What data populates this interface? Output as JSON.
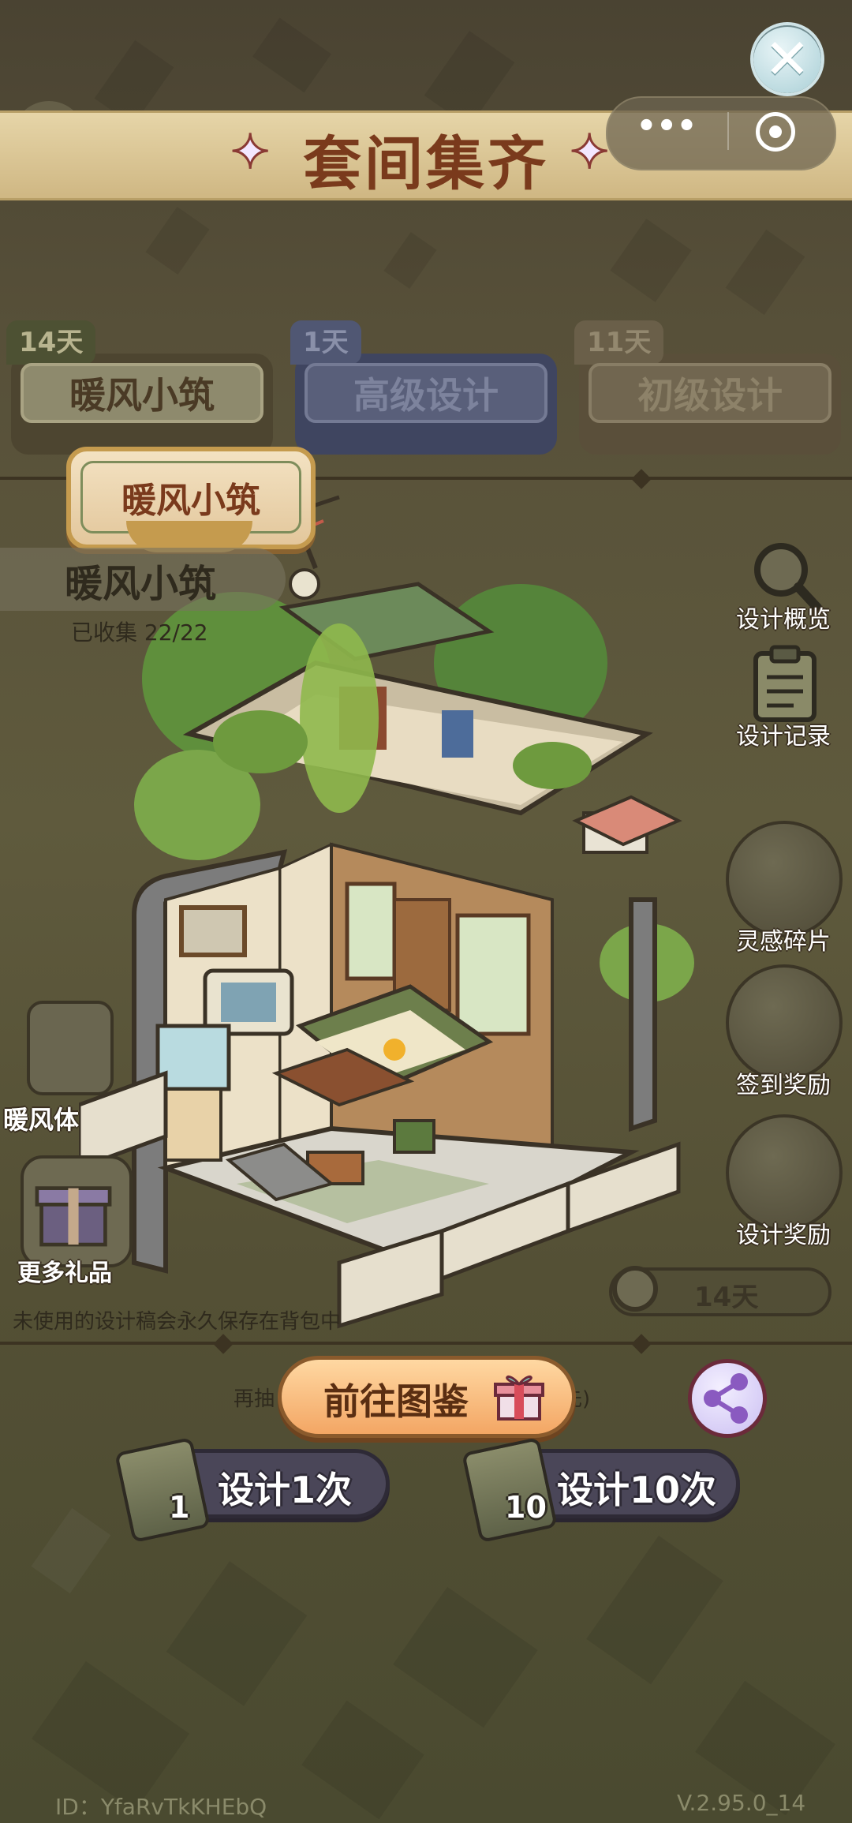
{
  "header": {
    "title": "套间集齐",
    "close_glyph": "✕",
    "star_glyph": "✦",
    "capsule_more": "•••"
  },
  "tabs": [
    {
      "days": "14天",
      "label": "暖风小筑"
    },
    {
      "days": "1天",
      "label": "高级设计"
    },
    {
      "days": "11天",
      "label": "初级设计"
    }
  ],
  "suite": {
    "badge_label": "暖风小筑",
    "name": "暖风小筑",
    "collected": "已收集 22/22"
  },
  "side_buttons": {
    "overview": "设计概览",
    "records": "设计记录",
    "fragments": "灵感碎片",
    "checkin": "签到奖励",
    "reward": "设计奖励"
  },
  "left_buttons": {
    "warm": "暖风体",
    "more_gifts": "更多礼品"
  },
  "note": "未使用的设计稿会永久保存在背包中",
  "timer": "14天",
  "bottom": {
    "redraw_prefix": "再抽",
    "redraw_suffix": "先)",
    "goto_label": "前往图鉴",
    "design_once": "设计1次",
    "design_once_count": "1",
    "design_ten": "设计10次",
    "design_ten_count": "10"
  },
  "footer": {
    "user_id": "ID：YfaRvTkKHEbQ",
    "version": "V.2.95.0_14"
  },
  "icons": [
    "close-icon",
    "sparkle-icon",
    "more-icon",
    "target-icon",
    "magnifier-icon",
    "clipboard-icon",
    "map-icon",
    "calendar-icon",
    "plant-icon",
    "gift-icon",
    "clock-icon",
    "share-icon",
    "scroll-icon"
  ],
  "colors": {
    "title": "#7a3a1c",
    "banner": "#e6d5a8",
    "goto_button": "#f3a664",
    "design_button": "#4a4658"
  }
}
